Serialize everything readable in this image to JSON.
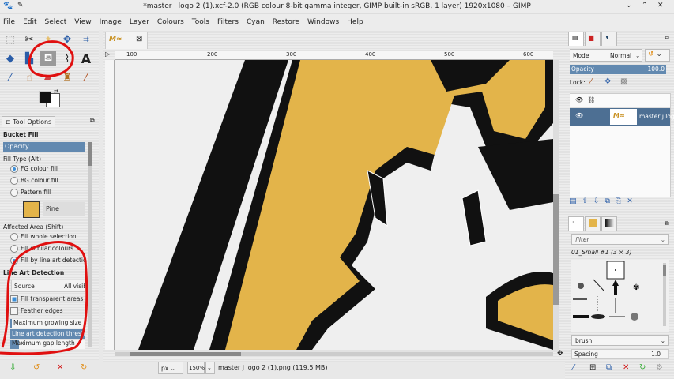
{
  "window": {
    "title": "*master j logo 2 (1).xcf-2.0 (RGB colour 8-bit gamma integer, GIMP built-in sRGB, 1 layer) 1920x1080 – GIMP",
    "controls": [
      "⌄",
      "⌃",
      "✕"
    ]
  },
  "menu": [
    "File",
    "Edit",
    "Select",
    "View",
    "Image",
    "Layer",
    "Colours",
    "Tools",
    "Filters",
    "Cyan",
    "Restore",
    "Windows",
    "Help"
  ],
  "tool_options": {
    "tab": "Tool Options",
    "tool": "Bucket Fill",
    "opacity_label": "Opacity",
    "fill_type_label": "Fill Type  (Alt)",
    "fill_types": [
      "FG colour fill",
      "BG colour fill",
      "Pattern fill"
    ],
    "pattern_name": "Pine",
    "affected_label": "Affected Area  (Shift)",
    "affected": [
      "Fill whole selection",
      "Fill similar colours",
      "Fill by line art detection"
    ],
    "line_art_label": "Line Art Detection",
    "source_label": "Source",
    "source_value": "All visible",
    "fill_transparent": "Fill transparent areas",
    "feather": "Feather edges",
    "max_grow": "Maximum growing size",
    "threshold": "Line art detection threshold",
    "max_gap": "Maximum gap length"
  },
  "rulers": [
    "100",
    "200",
    "300",
    "400",
    "500",
    "600"
  ],
  "status": {
    "unit": "px",
    "zoom": "150%",
    "file": "master j logo 2 (1).png (119.5 MB)"
  },
  "layers": {
    "mode_label": "Mode",
    "mode_value": "Normal",
    "opacity_label": "Opacity",
    "opacity_value": "100.0",
    "lock_label": "Lock:",
    "layer_name": "master j logo"
  },
  "brushes": {
    "filter_placeholder": "filter",
    "brush_name": "01_Small #1 (3 × 3)",
    "tag_value": "brush,",
    "spacing_label": "Spacing",
    "spacing_value": "1.0"
  },
  "colors": {
    "accent": "#6289b0",
    "gold": "#e3b44a",
    "annotation": "#e01010"
  }
}
